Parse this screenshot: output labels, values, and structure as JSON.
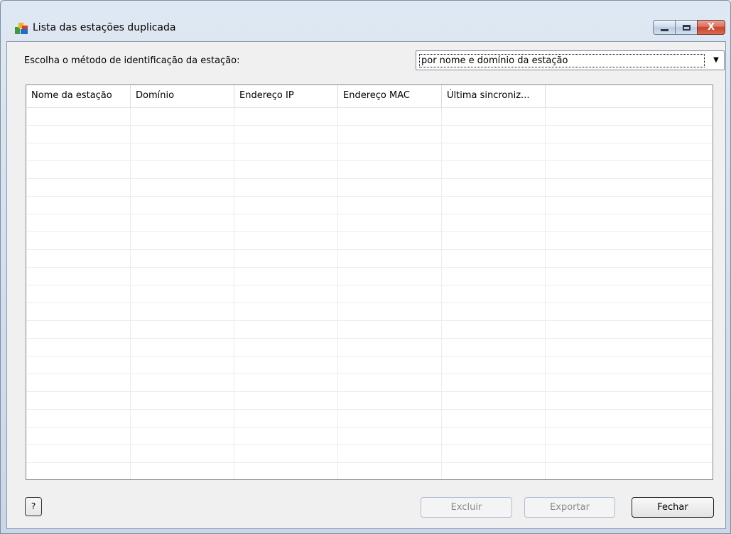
{
  "window": {
    "title": "Lista das estações duplicada",
    "close_glyph": "X"
  },
  "method": {
    "label": "Escolha o método de identificação da estação:",
    "selected": "por nome e domínio da estação",
    "arrow": "▼"
  },
  "grid": {
    "columns": [
      "Nome da estação",
      "Domínio",
      "Endereço IP",
      "Endereço MAC",
      "Última sincroniz...",
      ""
    ],
    "empty_rows": 21
  },
  "buttons": {
    "help": "?",
    "excluir": "Excluir",
    "exportar": "Exportar",
    "fechar": "Fechar"
  },
  "colors": {
    "accent_close": "#c7432b",
    "window_frame": "#c9d7e6",
    "disabled_text": "#8b8b8b"
  },
  "icons": [
    "avg-app-icon",
    "minimize-icon",
    "maximize-icon",
    "close-icon",
    "dropdown-arrow-icon"
  ]
}
